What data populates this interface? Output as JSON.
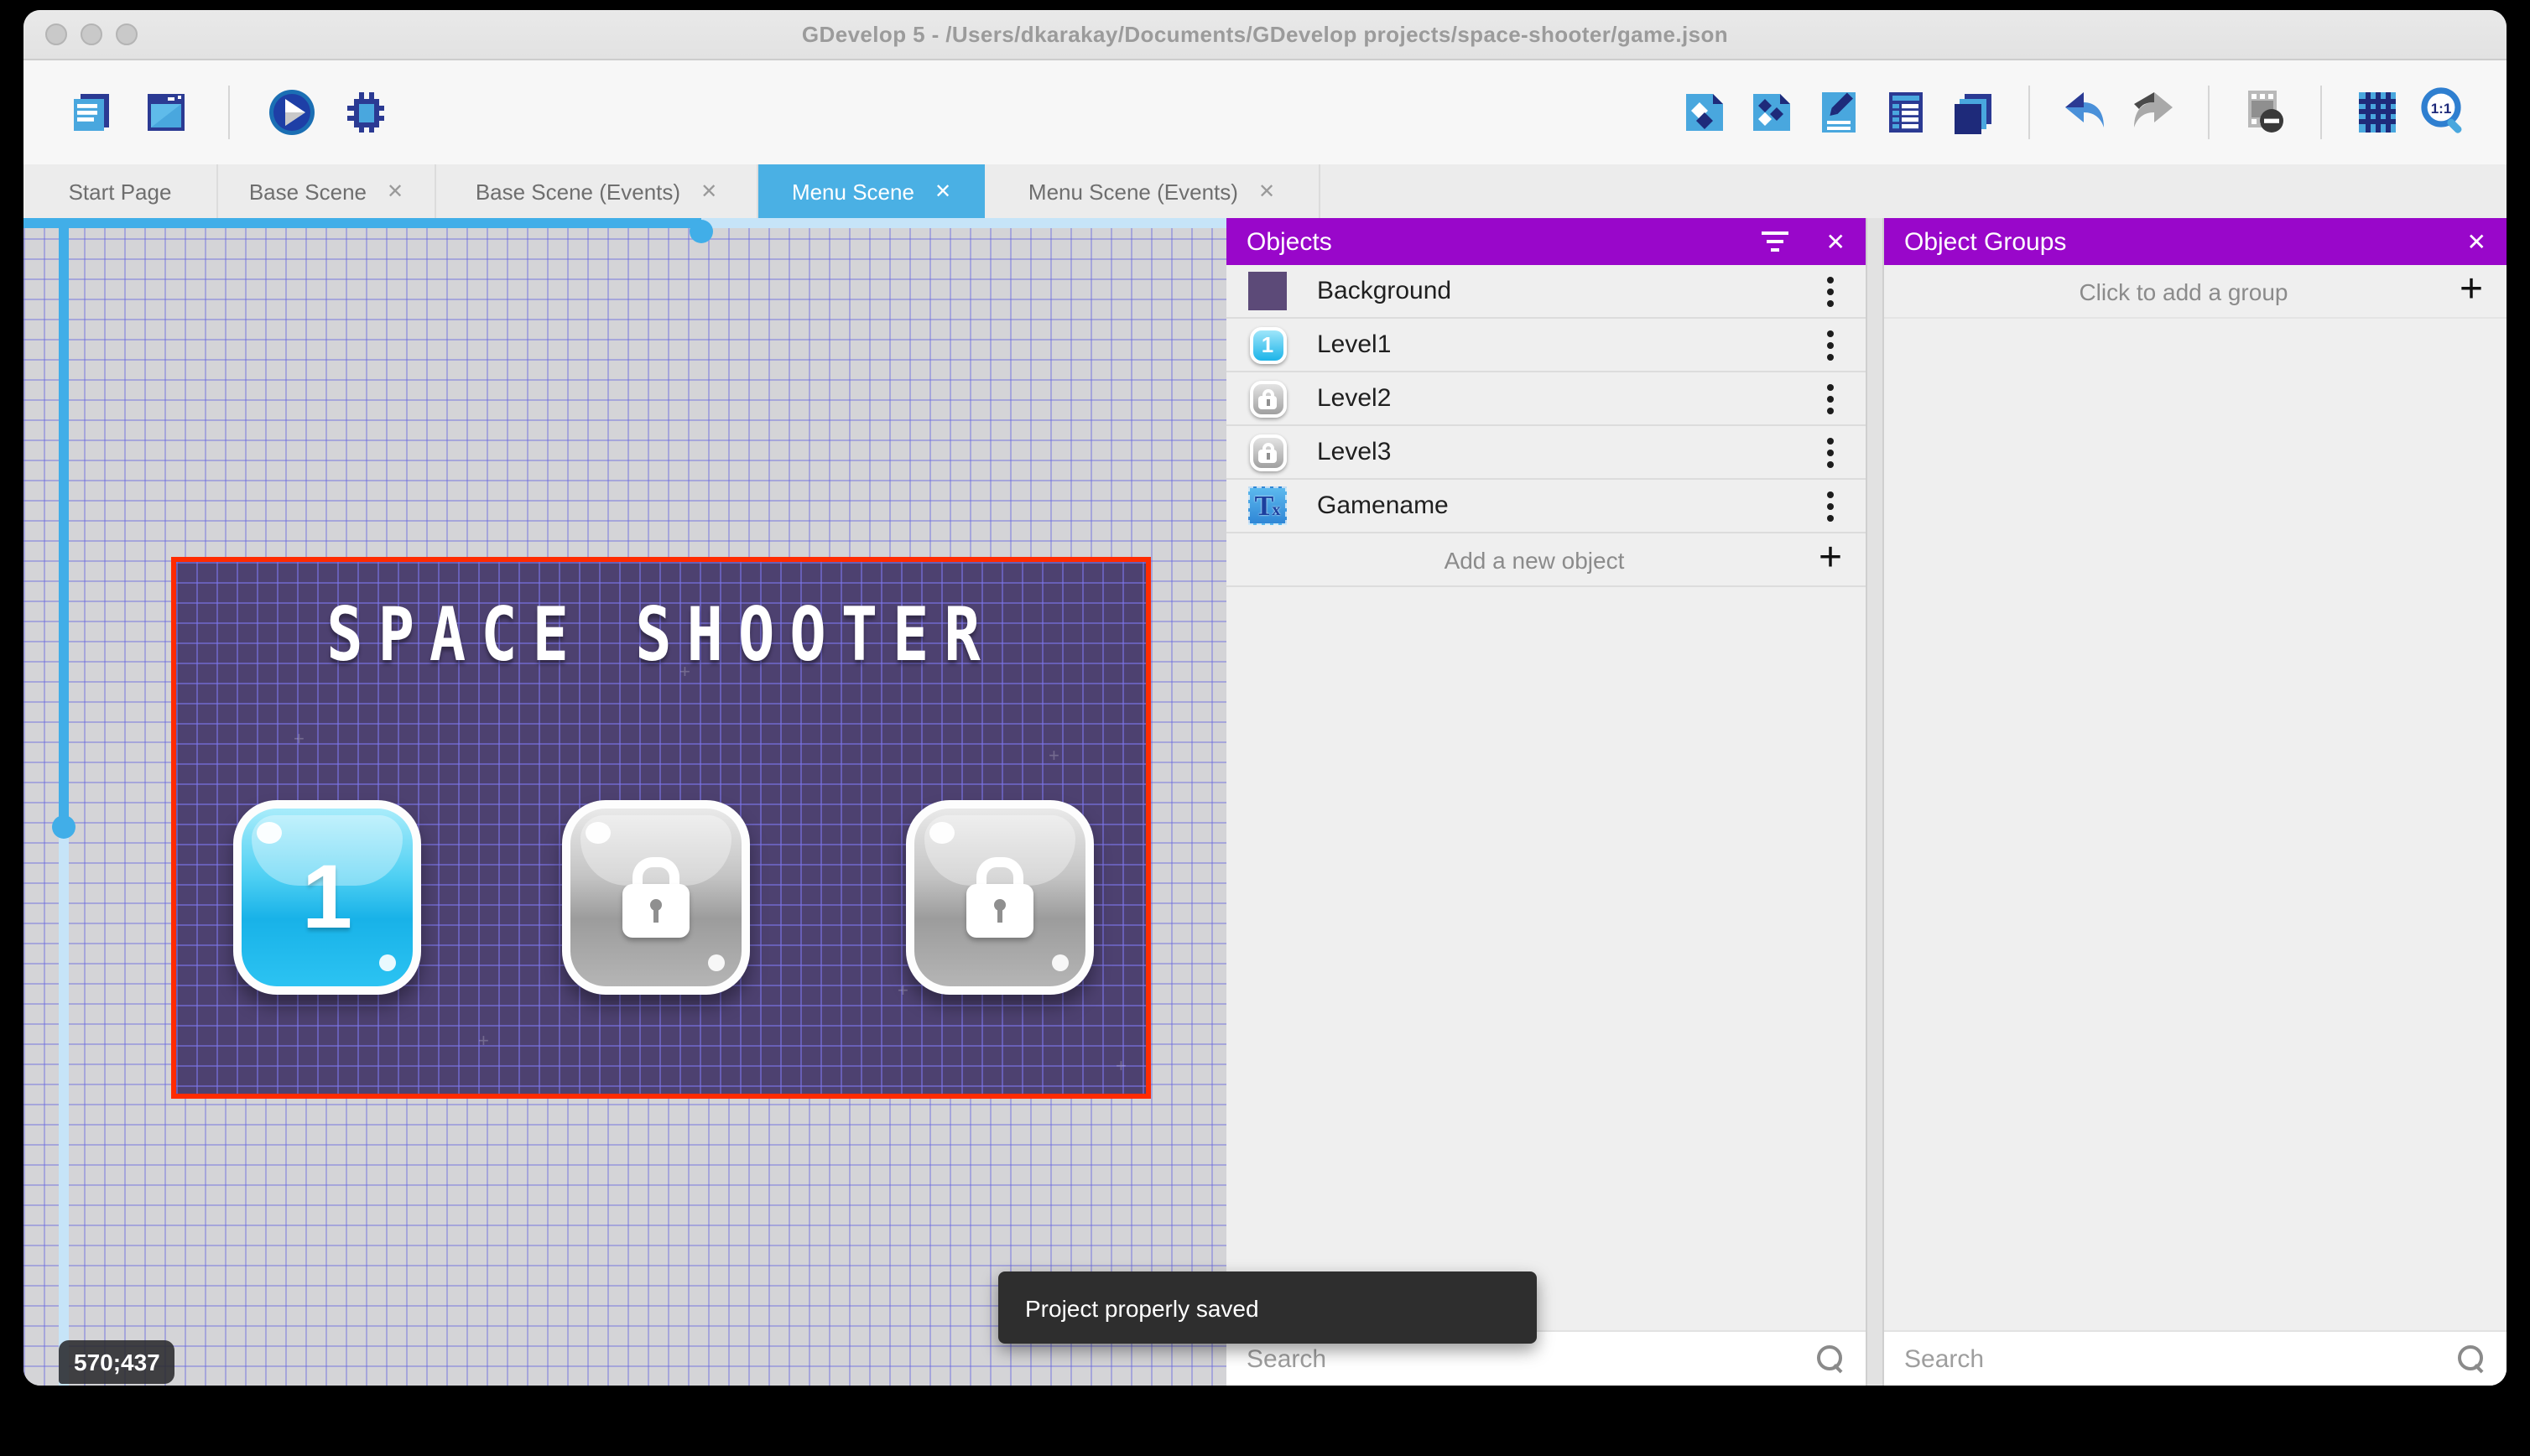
{
  "window": {
    "title": "GDevelop 5 - /Users/dkarakay/Documents/GDevelop projects/space-shooter/game.json"
  },
  "toolbar": {
    "left_icons": [
      "project-manager",
      "scene-editor",
      "play",
      "debug"
    ],
    "right_icons": [
      "objects-editor",
      "object-groups-editor",
      "properties",
      "instances-list",
      "layers",
      "undo",
      "redo",
      "mask",
      "grid",
      "zoom-original"
    ],
    "zoom_icon_label": "1:1"
  },
  "tabs": [
    {
      "label": "Start Page",
      "closable": false,
      "active": false
    },
    {
      "label": "Base Scene",
      "closable": true,
      "active": false
    },
    {
      "label": "Base Scene (Events)",
      "closable": true,
      "active": false
    },
    {
      "label": "Menu Scene",
      "closable": true,
      "active": true
    },
    {
      "label": "Menu Scene (Events)",
      "closable": true,
      "active": false
    }
  ],
  "canvas": {
    "coordinates": "570;437",
    "scene": {
      "title": "SPACE SHOOTER",
      "buttons": [
        {
          "state": "unlocked",
          "icon_text": "1"
        },
        {
          "state": "locked",
          "icon_text": ""
        },
        {
          "state": "locked",
          "icon_text": ""
        }
      ]
    }
  },
  "objects_panel": {
    "title": "Objects",
    "items": [
      {
        "label": "Background",
        "icon": "color-square"
      },
      {
        "label": "Level1",
        "icon": "button-1",
        "icon_text": "1"
      },
      {
        "label": "Level2",
        "icon": "button-lock"
      },
      {
        "label": "Level3",
        "icon": "button-lock"
      },
      {
        "label": "Gamename",
        "icon": "text-object",
        "icon_text_main": "T",
        "icon_text_sub": "x"
      }
    ],
    "add_label": "Add a new object",
    "search_placeholder": "Search"
  },
  "groups_panel": {
    "title": "Object Groups",
    "add_label": "Click to add a group",
    "search_placeholder": "Search"
  },
  "toast": {
    "message": "Project properly saved"
  },
  "icons": {
    "close": "✕",
    "plus": "+"
  },
  "colors": {
    "accent_purple": "#9907ca",
    "accent_blue": "#4ab0e4",
    "selection_red": "#ff2b00",
    "scene_purple": "#4d4170"
  }
}
